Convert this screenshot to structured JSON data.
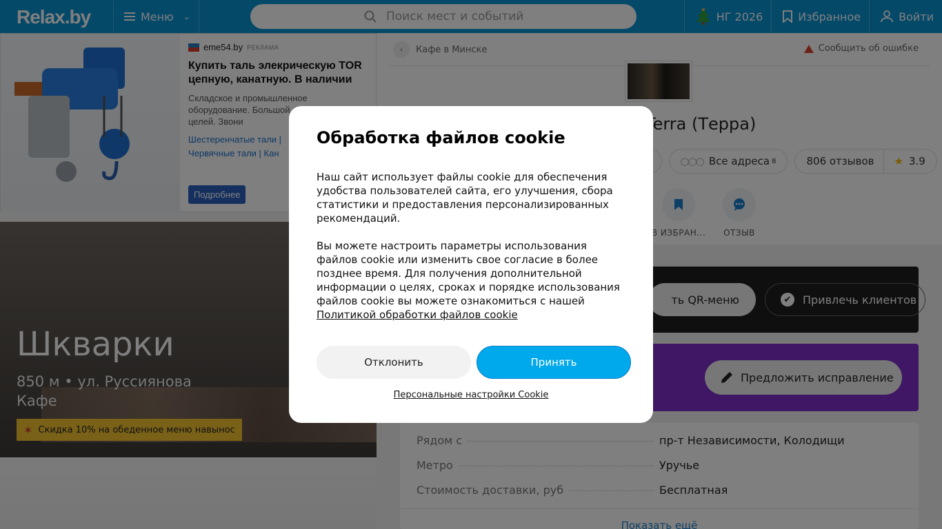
{
  "header": {
    "logo": "Relax.by",
    "menu_label": "Меню",
    "search_placeholder": "Поиск мест и событий",
    "ny_label": "НГ 2026",
    "favorites_label": "Избранное",
    "login_label": "Войти"
  },
  "ad": {
    "source": "eme54.by",
    "tag": "РЕКЛАМА",
    "title": "Купить таль элекрическую TOR цепную, канатную. В наличии",
    "text": "Складское и промышленное оборудование. Большой для любых целей. Звони",
    "links_line1": "Шестеренчатые тали   |",
    "links_line2": "Червячные тали   |   Кан",
    "button": "Подробнее"
  },
  "hero": {
    "title": "Шкварки",
    "subtitle_line1": "850 м • ул. Руссиянова",
    "subtitle_line2": "Кафе",
    "badge": "Скидка 10% на обеденное меню навынос"
  },
  "place": {
    "breadcrumb": "Кафе в Минске",
    "report": "Сообщить об ошибке",
    "name": "Terra (Терра)",
    "pill_partial": "0",
    "all_addresses": "Все адреса",
    "addresses_count": "8",
    "reviews": "806 отзывов",
    "rating": "3.9",
    "action_favorite": "В ИЗБРАН...",
    "action_review": "ОТЗЫВ",
    "qr_menu": "ть QR-меню",
    "attract_clients": "Привлечь клиентов",
    "suggest_fix": "Предложить исправление",
    "info": [
      {
        "key": "Рядом с",
        "value": "пр-т Независимости, Колодищи"
      },
      {
        "key": "Метро",
        "value": "Уручье"
      },
      {
        "key": "Стоимость доставки, руб",
        "value": "Бесплатная"
      }
    ],
    "show_more": "Показать ещё"
  },
  "cookie": {
    "title": "Обработка файлов cookie",
    "para1": "Наш сайт использует файлы cookie для обеспечения удобства пользователей сайта, его улучшения, сбора статистики и предоставления персонализированных рекомендаций.",
    "para2": "Вы можете настроить параметры использования файлов cookie или изменить свое согласие в более позднее время. Для получения дополнительной информации о целях, сроках и порядке использования файлов cookie вы можете ознакомиться с нашей",
    "policy_link": "Политикой обработки файлов cookie",
    "decline": "Отклонить",
    "accept": "Принять",
    "settings": "Персональные настройки Cookie"
  }
}
